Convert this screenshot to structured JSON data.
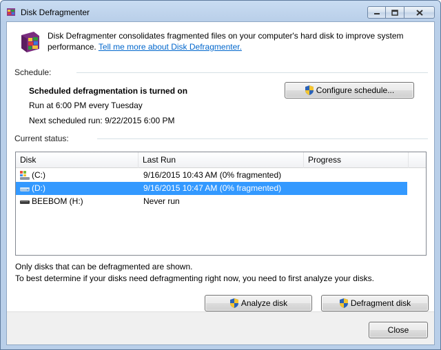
{
  "window": {
    "title": "Disk Defragmenter",
    "caption_buttons": [
      "minimize",
      "maximize",
      "close"
    ]
  },
  "intro": {
    "text": "Disk Defragmenter consolidates fragmented files on your computer's hard disk to improve system performance.",
    "link": "Tell me more about Disk Defragmenter."
  },
  "schedule": {
    "group_label": "Schedule:",
    "status": "Scheduled defragmentation is turned on",
    "run_at": "Run at 6:00 PM every Tuesday",
    "next_run": "Next scheduled run: 9/22/2015 6:00 PM",
    "configure_button": "Configure schedule..."
  },
  "current_status": {
    "group_label": "Current status:",
    "columns": [
      "Disk",
      "Last Run",
      "Progress"
    ],
    "rows": [
      {
        "disk": "(C:)",
        "last_run": "9/16/2015 10:43 AM (0% fragmented)",
        "progress": "",
        "icon": "system-drive-icon",
        "selected": false
      },
      {
        "disk": "(D:)",
        "last_run": "9/16/2015 10:47 AM (0% fragmented)",
        "progress": "",
        "icon": "hard-drive-icon",
        "selected": true
      },
      {
        "disk": "BEEBOM (H:)",
        "last_run": "Never run",
        "progress": "",
        "icon": "removable-drive-icon",
        "selected": false
      }
    ]
  },
  "notes": {
    "line1": "Only disks that can be defragmented are shown.",
    "line2": "To best determine if your disks need defragmenting right now, you need to first analyze your disks."
  },
  "actions": {
    "analyze_button": "Analyze disk",
    "defragment_button": "Defragment disk",
    "close_button": "Close"
  },
  "colors": {
    "selection": "#3399ff",
    "link": "#0066cc",
    "title_bar": "#b9cfe9"
  }
}
